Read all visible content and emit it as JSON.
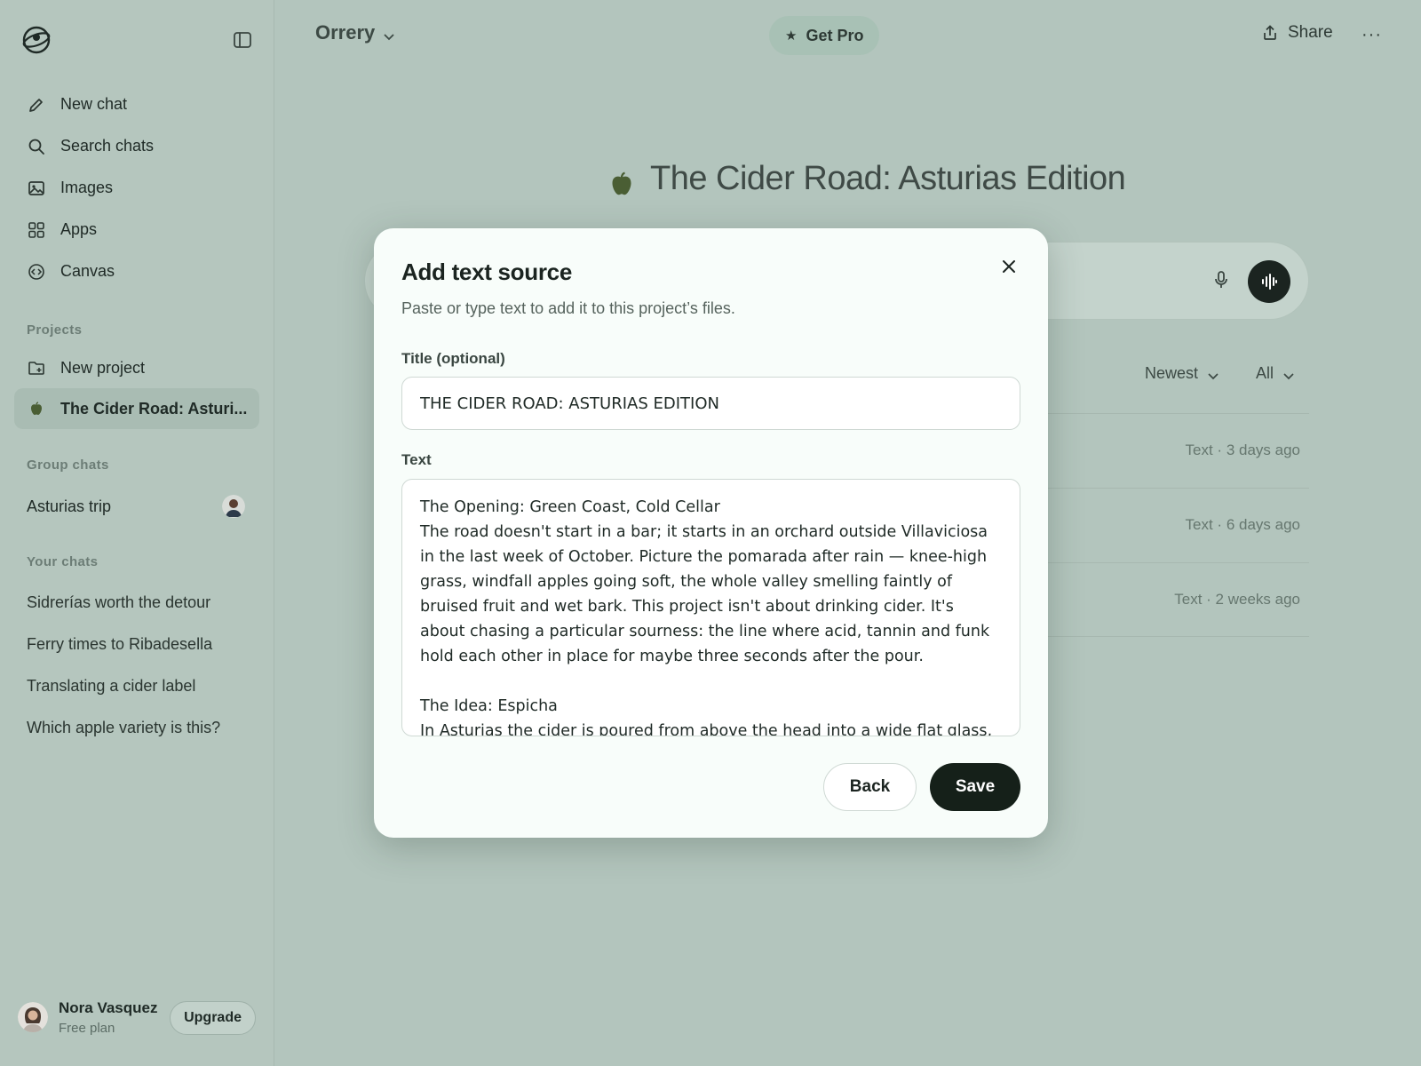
{
  "sidebar": {
    "nav": [
      {
        "label": "New chat",
        "icon": "pencil-icon"
      },
      {
        "label": "Search chats",
        "icon": "search-icon"
      },
      {
        "label": "Images",
        "icon": "image-icon"
      },
      {
        "label": "Apps",
        "icon": "apps-grid-icon"
      },
      {
        "label": "Canvas",
        "icon": "canvas-icon"
      }
    ],
    "projects_label": "Projects",
    "projects": [
      {
        "label": "New project",
        "icon": "new-folder-icon"
      },
      {
        "label": "The Cider Road: Asturi...",
        "icon": "apple-icon"
      }
    ],
    "group_chats_label": "Group chats",
    "group_chat": "Asturias trip",
    "your_chats_label": "Your chats",
    "chats": [
      "Sidrerías worth the detour",
      "Ferry times to Ribadesella",
      "Translating a cider label",
      "Which apple variety is this?"
    ],
    "user": {
      "name": "Nora Vasquez",
      "plan": "Free plan",
      "upgrade": "Upgrade"
    }
  },
  "header": {
    "model": "Orrery",
    "get_pro": "Get Pro",
    "share": "Share"
  },
  "project": {
    "title": "The Cider Road: Asturias Edition",
    "sort": "Newest",
    "filter": "All",
    "files": [
      {
        "meta": "Text · 3 days ago"
      },
      {
        "meta": "Text · 6 days ago"
      },
      {
        "meta": "Text · 2 weeks ago"
      }
    ]
  },
  "modal": {
    "title": "Add text source",
    "subtitle": "Paste or type text to add it to this project’s files.",
    "title_label": "Title (optional)",
    "title_value": "THE CIDER ROAD: ASTURIAS EDITION",
    "text_label": "Text",
    "text_value": "The Opening: Green Coast, Cold Cellar\nThe road doesn't start in a bar; it starts in an orchard outside Villaviciosa in the last week of October. Picture the pomarada after rain — knee-high grass, windfall apples going soft, the whole valley smelling faintly of bruised fruit and wet bark. This project isn't about drinking cider. It's about chasing a particular sourness: the line where acid, tannin and funk hold each other in place for maybe three seconds after the pour.\n\nThe Idea: Espicha\nIn Asturias the cider is poured from above the head into a wide flat glass, a few",
    "back": "Back",
    "save": "Save"
  },
  "colors": {
    "background": "#b3c5bd",
    "modal": "#f8fdfa",
    "primary_button": "#152019",
    "apple": "#4a5e34"
  }
}
